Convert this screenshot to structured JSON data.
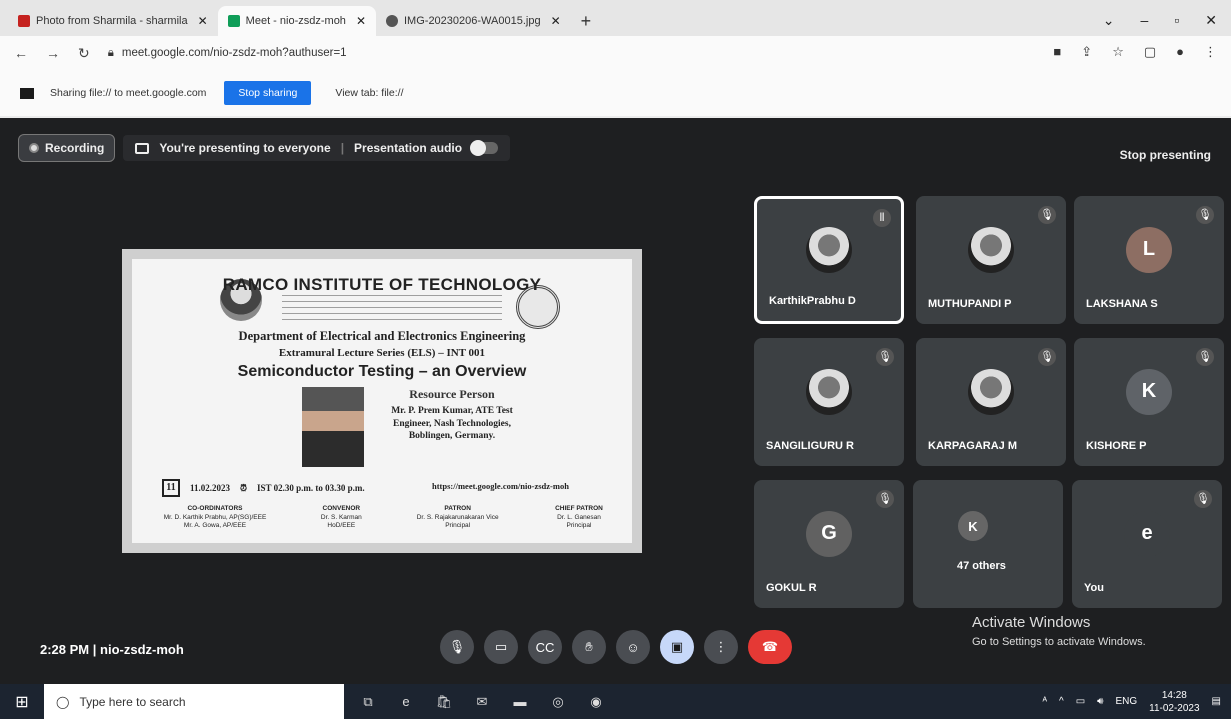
{
  "browser": {
    "tabs": [
      {
        "label": "Photo from Sharmila - sharmila",
        "close": "✕"
      },
      {
        "label": "Meet - nio-zsdz-moh",
        "close": "✕"
      },
      {
        "label": "IMG-20230206-WA0015.jpg",
        "close": "✕"
      }
    ],
    "new_tab": "+",
    "url": "meet.google.com/nio-zsdz-moh?authuser=1",
    "sharing_text": "Sharing file:// to meet.google.com",
    "stop_sharing": "Stop sharing",
    "view_tab": "View tab: file://"
  },
  "meet": {
    "recording": "Recording",
    "presenting": "You're presenting to everyone",
    "presentation_audio": "Presentation audio",
    "stop_presenting": "Stop presenting",
    "time": "2:28 PM",
    "separator": "|",
    "meeting_code": "nio-zsdz-moh",
    "activate_title": "Activate Windows",
    "activate_sub": "Go to Settings to activate Windows.",
    "participants": [
      {
        "name": "KarthikPrabhu D",
        "initial": ""
      },
      {
        "name": "MUTHUPANDI P",
        "initial": ""
      },
      {
        "name": "LAKSHANA S",
        "initial": "L"
      },
      {
        "name": "SANGILIGURU R",
        "initial": ""
      },
      {
        "name": "KARPAGARAJ M",
        "initial": ""
      },
      {
        "name": "KISHORE P",
        "initial": "K"
      },
      {
        "name": "GOKUL R",
        "initial": "G"
      },
      {
        "name": "47 others",
        "initial": "K"
      },
      {
        "name": "You",
        "initial": "e"
      }
    ]
  },
  "slide": {
    "institute": "RAMCO INSTITUTE OF TECHNOLOGY",
    "department": "Department of Electrical and Electronics Engineering",
    "series": "Extramural Lecture Series (ELS) – INT 001",
    "topic": "Semiconductor Testing – an Overview",
    "resource_heading": "Resource Person",
    "resource_lines": "Mr. P. Prem Kumar, ATE Test Engineer, Nash Technologies, Boblingen, Germany.",
    "date_day": "11",
    "date": "11.02.2023",
    "time": "IST 02.30 p.m. to 03.30 p.m.",
    "link": "https://meet.google.com/nio-zsdz-moh",
    "footer": [
      {
        "role": "CO-ORDINATORS",
        "names": "Mr. D. Karthik Prabhu, AP(SG)/EEE  Mr. A. Gowa, AP/EEE"
      },
      {
        "role": "CONVENOR",
        "names": "Dr. S. Karman HoD/EEE"
      },
      {
        "role": "PATRON",
        "names": "Dr. S. Rajakarunakaran Vice Principal"
      },
      {
        "role": "CHIEF PATRON",
        "names": "Dr. L. Ganesan Principal"
      }
    ]
  },
  "taskbar": {
    "search_placeholder": "Type here to search",
    "lang": "ENG",
    "clock_time": "14:28",
    "clock_date": "11-02-2023"
  }
}
